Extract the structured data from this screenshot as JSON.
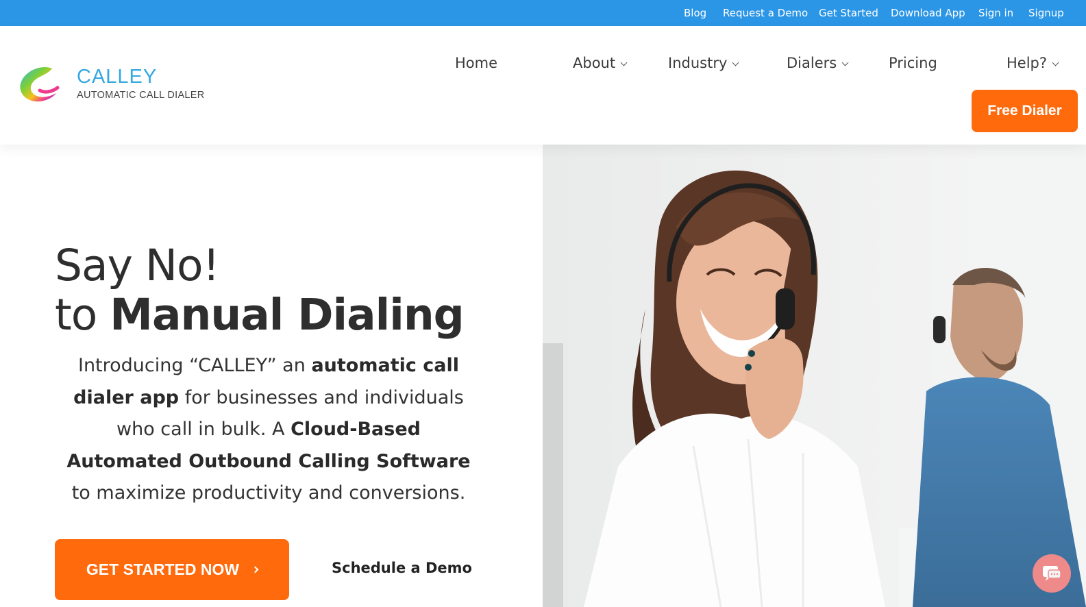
{
  "topbar": {
    "links": [
      "Blog",
      "Request a Demo",
      "Get Started",
      "Download App",
      "Sign in",
      "Signup"
    ]
  },
  "brand": {
    "name": "CALLEY",
    "tagline": "AUTOMATIC CALL DIALER"
  },
  "nav": {
    "home": "Home",
    "about": "About",
    "industry": "Industry",
    "dialers": "Dialers",
    "pricing": "Pricing",
    "help": "Help?",
    "free_dialer": "Free Dialer"
  },
  "hero": {
    "line1": "Say No!",
    "line2_prefix": "to ",
    "line2_bold": "Manual Dialing",
    "intro": {
      "t1": "Introducing “CALLEY” an ",
      "b1": "automatic call dialer app",
      "t2": " for businesses and individuals who call in bulk. A ",
      "b2": "Cloud-Based Automated Outbound Calling Software",
      "t3": " to maximize productivity and conversions."
    },
    "cta_primary": "GET STARTED NOW",
    "cta_secondary": "Schedule a Demo"
  },
  "colors": {
    "topbar": "#2b95e6",
    "accent_orange": "#ff6a0c",
    "brand_blue": "#35a8df",
    "chat": "#ee8a8a"
  },
  "icons": {
    "logo": "calley-swirl-logo",
    "chat": "chat-bubble-icon"
  }
}
